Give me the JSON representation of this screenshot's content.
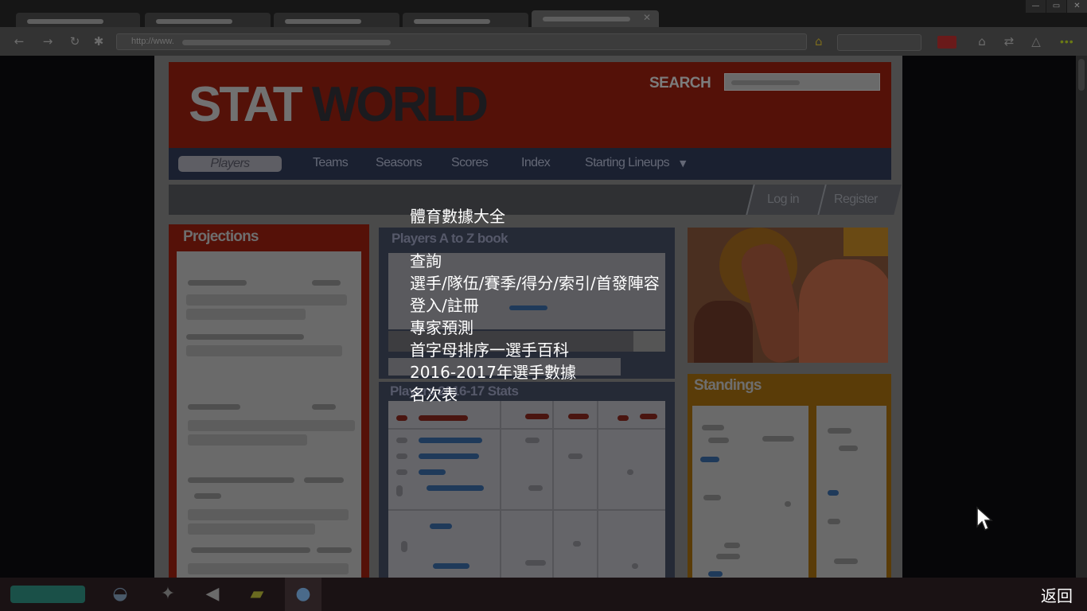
{
  "browser": {
    "address_url": "http://www.",
    "tab_close_glyph": "✕"
  },
  "site": {
    "logo_part1": "STAT",
    "logo_part2": "WORLD",
    "search_label": "SEARCH",
    "nav": {
      "players": "Players",
      "teams": "Teams",
      "seasons": "Seasons",
      "scores": "Scores",
      "index": "Index",
      "starting_lineups": "Starting Lineups"
    },
    "login": "Log in",
    "register": "Register",
    "projections_title": "Projections",
    "players_az_title": "Players A to Z book",
    "players_stats_title": "Players 2016-17 Stats",
    "standings_title": "Standings"
  },
  "overlay": {
    "line1": "體育數據大全",
    "line2": "查詢",
    "line3": "選手/隊伍/賽季/得分/索引/首發陣容",
    "line4": "登入/註冊",
    "line5": "專家預測",
    "line6": "首字母排序一選手百科",
    "line7": "2016-2017年選手數據",
    "line8": "名次表"
  },
  "taskbar": {
    "back_label": "返回"
  },
  "icons": {
    "back": "back-arrow-icon",
    "forward": "forward-arrow-icon",
    "reload": "reload-icon",
    "extensions": "puzzle-icon",
    "home": "home-icon",
    "menu": "menu-dots-icon"
  },
  "colors": {
    "header_red": "#541108",
    "nav_navy": "#1a2030",
    "standings_amber": "#5a3c08",
    "overlay_text": "#ffffff"
  }
}
